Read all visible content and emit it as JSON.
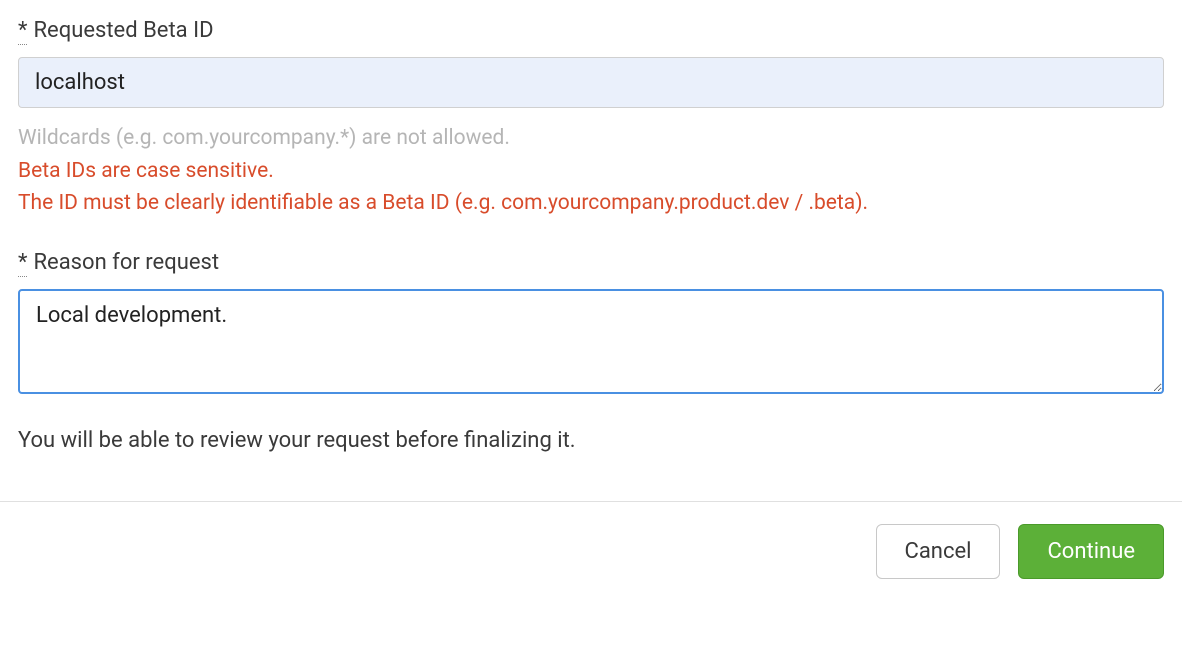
{
  "form": {
    "beta_id": {
      "required_marker": "*",
      "label": "Requested Beta ID",
      "value": "localhost",
      "help": {
        "wildcards": "Wildcards (e.g. com.yourcompany.*) are not allowed.",
        "case_sensitive": "Beta IDs are case sensitive.",
        "identifiable": "The ID must be clearly identifiable as a Beta ID (e.g. com.yourcompany.product.dev / .beta)."
      }
    },
    "reason": {
      "required_marker": "*",
      "label": "Reason for request",
      "value": "Local development."
    },
    "review_notice": "You will be able to review your request before finalizing it."
  },
  "buttons": {
    "cancel": "Cancel",
    "continue": "Continue"
  }
}
